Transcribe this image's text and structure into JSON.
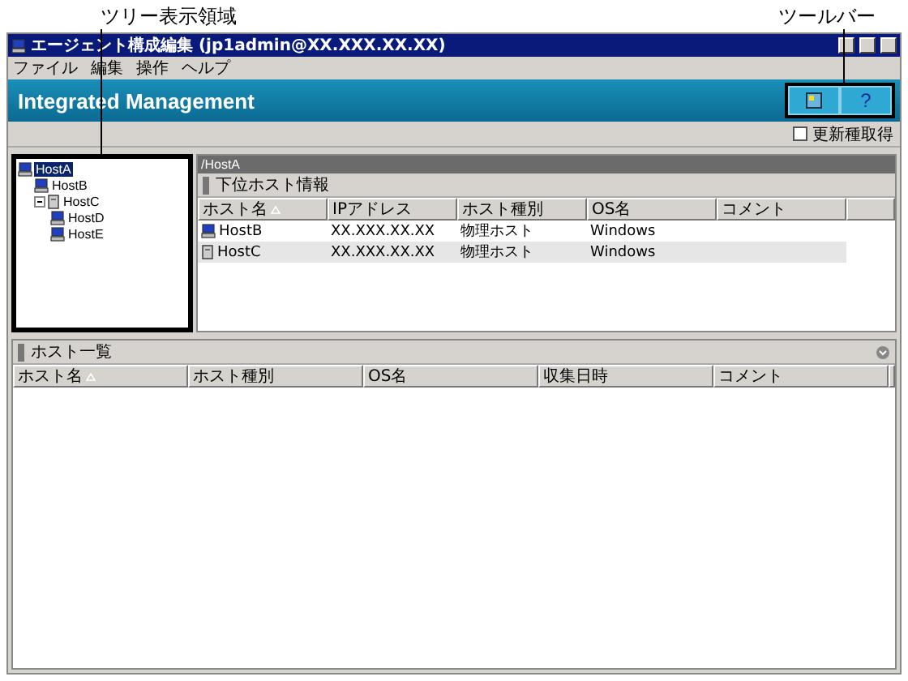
{
  "callouts": [
    {
      "text": "ツリー表示領域"
    },
    {
      "text": "ツールバー"
    }
  ],
  "window": {
    "title": "エージェント構成編集 (jp1admin@XX.XXX.XX.XX)"
  },
  "menu": [
    "ファイル",
    "編集",
    "操作",
    "ヘルプ"
  ],
  "banner": {
    "title": "Integrated Management"
  },
  "toolbar": [
    {
      "kind": "icon"
    },
    {
      "kind": "text",
      "label": "?"
    }
  ],
  "option": {
    "label": "更新種取得",
    "checked": false
  },
  "tree": [
    {
      "label": "HostA",
      "kind": "pc",
      "selected": true,
      "children": [
        {
          "label": "HostB",
          "kind": "pc",
          "selected": false
        },
        {
          "label": "HostC",
          "kind": "server",
          "selected": false,
          "expanded": true,
          "children": [
            {
              "label": "HostD",
              "kind": "pc",
              "selected": false
            },
            {
              "label": "HostE",
              "kind": "pc",
              "selected": false
            }
          ]
        }
      ]
    }
  ],
  "detail": {
    "path": "/HostA",
    "section": "下位ホスト情報",
    "columns": [
      {
        "label": "ホスト名",
        "sorted": true
      },
      {
        "label": "IPアドレス",
        "sorted": false
      },
      {
        "label": "ホスト種別",
        "sorted": false
      },
      {
        "label": "OS名",
        "sorted": false
      },
      {
        "label": "コメント",
        "sorted": false
      }
    ],
    "rows": [
      {
        "kind": "pc",
        "cells": [
          "HostB",
          "XX.XXX.XX.XX",
          "物理ホスト",
          "Windows"
        ]
      },
      {
        "kind": "server",
        "cells": [
          "HostC",
          "XX.XXX.XX.XX",
          "物理ホスト",
          "Windows"
        ]
      }
    ]
  },
  "list": {
    "section": "ホスト一覧",
    "columns": [
      {
        "label": "ホスト名",
        "sorted": true
      },
      {
        "label": "ホスト種別",
        "sorted": false
      },
      {
        "label": "OS名",
        "sorted": false
      },
      {
        "label": "収集日時",
        "sorted": false
      },
      {
        "label": "コメント",
        "sorted": false
      }
    ]
  }
}
